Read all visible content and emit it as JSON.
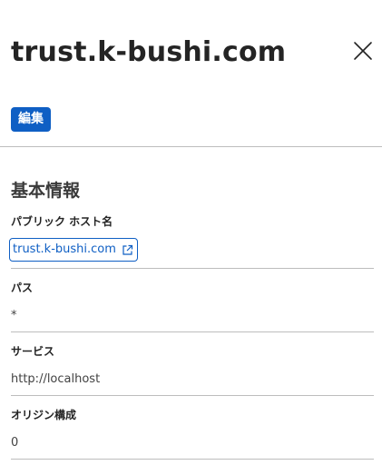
{
  "header": {
    "title": "trust.k-bushi.com",
    "close_icon": "close-icon"
  },
  "toolbar": {
    "edit_label": "編集"
  },
  "section": {
    "title": "基本情報"
  },
  "fields": {
    "public_hostname": {
      "label": "パブリック ホスト名",
      "value": "trust.k-bushi.com",
      "icon": "external-link-icon"
    },
    "path": {
      "label": "パス",
      "value": "*"
    },
    "service": {
      "label": "サービス",
      "value": "http://localhost"
    },
    "origin_config": {
      "label": "オリジン構成",
      "value": "0"
    }
  },
  "colors": {
    "accent": "#0f5fc4",
    "divider": "#bdbdbd",
    "text": "#242424"
  }
}
